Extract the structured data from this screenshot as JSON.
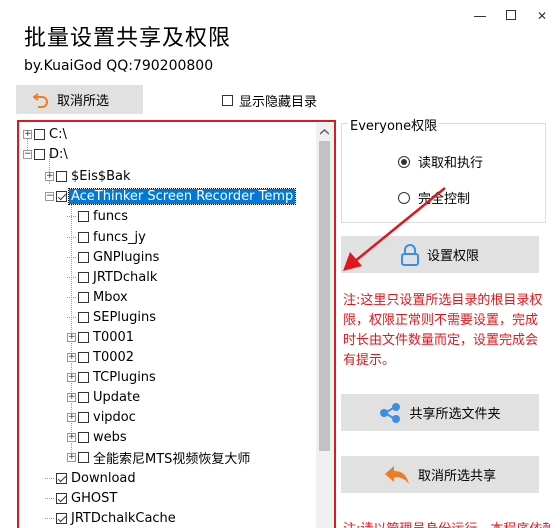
{
  "window": {
    "title": "批量设置共享及权限",
    "byline": "by.KuaiGod  QQ:790200800",
    "controls": {
      "minimize": "—",
      "maximize": "□",
      "close": "✕"
    }
  },
  "toolbar": {
    "cancel_selection_label": "取消所选",
    "show_hidden_label": "显示隐藏目录",
    "show_hidden_checked": false
  },
  "tree": {
    "nodes": [
      {
        "label": "C:\\",
        "checked": false,
        "expander": "+"
      },
      {
        "label": "D:\\",
        "checked": false,
        "expander": "-"
      },
      {
        "label": "$Eis$Bak",
        "checked": false,
        "expander": "+"
      },
      {
        "label": "AceThinker Screen Recorder Temp",
        "checked": true,
        "expander": "-",
        "selected": true
      },
      {
        "label": "funcs",
        "checked": false,
        "expander": ""
      },
      {
        "label": "funcs_jy",
        "checked": false,
        "expander": ""
      },
      {
        "label": "GNPlugins",
        "checked": false,
        "expander": ""
      },
      {
        "label": "JRTDchalk",
        "checked": false,
        "expander": ""
      },
      {
        "label": "Mbox",
        "checked": false,
        "expander": ""
      },
      {
        "label": "SEPlugins",
        "checked": false,
        "expander": ""
      },
      {
        "label": "T0001",
        "checked": false,
        "expander": "+"
      },
      {
        "label": "T0002",
        "checked": false,
        "expander": "+"
      },
      {
        "label": "TCPlugins",
        "checked": false,
        "expander": "+"
      },
      {
        "label": "Update",
        "checked": false,
        "expander": "+"
      },
      {
        "label": "vipdoc",
        "checked": false,
        "expander": "+"
      },
      {
        "label": "webs",
        "checked": false,
        "expander": "+"
      },
      {
        "label": "全能索尼MTS视频恢复大师",
        "checked": false,
        "expander": "+"
      },
      {
        "label": "Download",
        "checked": true,
        "expander": ""
      },
      {
        "label": "GHOST",
        "checked": true,
        "expander": ""
      },
      {
        "label": "JRTDchalkCache",
        "checked": true,
        "expander": ""
      }
    ]
  },
  "permissions": {
    "group_label": "Everyone权限",
    "options": [
      {
        "label": "读取和执行",
        "selected": true
      },
      {
        "label": "完全控制",
        "selected": false
      }
    ],
    "set_button_label": "设置权限"
  },
  "note": "注:这里只设置所选目录的根目录权限，权限正常则不需要设置，完成时长由文件数量而定，设置完成会有提示。",
  "share_button_label": "共享所选文件夹",
  "unshare_button_label": "取消所选共享",
  "footer_note": "注:请以管理员身份运行，本程序依赖",
  "colors": {
    "accent_red": "#e0171d",
    "selection_blue": "#0078d7",
    "icon_blue": "#3a8ee6",
    "undo_orange": "#f07c22"
  }
}
